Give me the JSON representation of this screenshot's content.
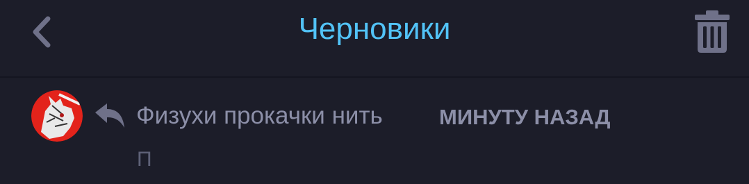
{
  "header": {
    "title": "Черновики",
    "back_icon": "chevron-left-icon",
    "trash_icon": "trash-icon"
  },
  "drafts": [
    {
      "subject": "Физухи прокачки нить",
      "time": "МИНУТУ НАЗАД",
      "preview": "П",
      "reply_icon": "reply-icon",
      "avatar": "user-avatar"
    }
  ],
  "colors": {
    "background": "#1c1d29",
    "accent": "#52c3f7",
    "icon": "#6f7189",
    "text_secondary": "#8c8fa8",
    "avatar_bg": "#e3231b"
  }
}
